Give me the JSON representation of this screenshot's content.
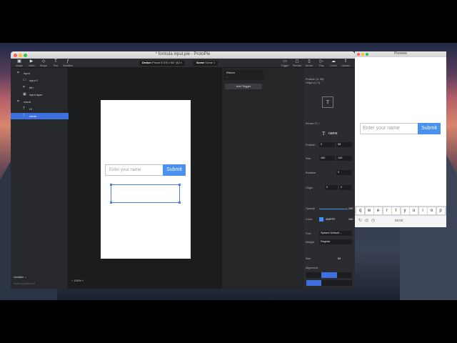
{
  "main_window": {
    "title": "* formula input.pie - ProtoPie",
    "toolbar": {
      "tools": [
        {
          "label": "Image",
          "icon": "image-icon",
          "glyph": "▣"
        },
        {
          "label": "Video",
          "icon": "video-icon",
          "glyph": "▶"
        },
        {
          "label": "Shape",
          "icon": "shape-icon",
          "glyph": "◇"
        },
        {
          "label": "Text",
          "icon": "text-icon",
          "glyph": "T"
        },
        {
          "label": "Variables",
          "icon": "variables-icon",
          "glyph": "ƒ"
        }
      ],
      "device_label": "Device",
      "device_value": "iPhone 8  375 x 667  @2 x",
      "scene_label": "Scene",
      "scene_value": "Scene 1",
      "right_tools": [
        {
          "label": "Trigger",
          "icon": "trigger-icon",
          "glyph": "▭"
        },
        {
          "label": "Preview",
          "icon": "preview-icon",
          "glyph": "◻"
        },
        {
          "label": "Device",
          "icon": "device-icon",
          "glyph": "▯"
        },
        {
          "label": "Play",
          "icon": "play-icon",
          "glyph": "▷"
        },
        {
          "label": "Cloud",
          "icon": "cloud-icon",
          "glyph": "☁"
        },
        {
          "label": "Upload",
          "icon": "upload-icon",
          "glyph": "⇪"
        }
      ]
    },
    "layers": [
      {
        "label": "input",
        "icon": "group-icon",
        "glyph": "⌗",
        "indent": 0,
        "selected": false
      },
      {
        "label": "input 1",
        "icon": "rect-icon",
        "glyph": "▭",
        "indent": 1,
        "selected": false
      },
      {
        "label": "btn",
        "icon": "group-icon",
        "glyph": "⌗",
        "indent": 1,
        "selected": false
      },
      {
        "label": "input layer",
        "icon": "image-icon",
        "glyph": "▣",
        "indent": 1,
        "selected": false
      },
      {
        "label": "result",
        "icon": "group-icon",
        "glyph": "⌗",
        "indent": 0,
        "selected": false
      },
      {
        "label": "Hi",
        "icon": "text-icon",
        "glyph": "T",
        "indent": 1,
        "selected": false
      },
      {
        "label": "name",
        "icon": "text-icon",
        "glyph": "T",
        "indent": 1,
        "selected": true
      }
    ],
    "variables": {
      "label": "Variable",
      "placeholder": "Nothing selected"
    },
    "zoom": "100%",
    "canvas": {
      "input_placeholder": "Enter your name",
      "button_label": "Submit"
    },
    "interactions": {
      "trigger_label": "Return",
      "trigger_sub": "+",
      "add_trigger": "Add Trigger"
    },
    "props": {
      "position_info": "Position  (0, 58)",
      "origin_info": "Origin  (0, 0)",
      "resize_info": "Resize  T1  ↕",
      "layer_name": "name",
      "position": {
        "label": "Position",
        "x": "0",
        "y": "58"
      },
      "size": {
        "label": "Size",
        "w": "280",
        "h": "140"
      },
      "rotation": {
        "label": "Rotation",
        "value": "0"
      },
      "origin": {
        "label": "Origin",
        "x": "0",
        "y": "0"
      },
      "opacity": {
        "label": "Opacity",
        "value": "100",
        "level": 1.0
      },
      "color": {
        "label": "Color",
        "hex": "408FFF",
        "alpha": "100",
        "swatch": "#408fff"
      },
      "font": {
        "label": "Font",
        "value": "System Default ..."
      },
      "weight": {
        "label": "Weight",
        "value": "Regular"
      },
      "size_font": {
        "label": "Size",
        "value": "60"
      },
      "alignment": {
        "label": "Alignment"
      }
    }
  },
  "preview_window": {
    "title": "Preview",
    "input_placeholder": "Enter your name",
    "button_label": "Submit",
    "keyboard_keys": [
      "q",
      "w",
      "e",
      "r",
      "t",
      "y",
      "u",
      "i",
      "o",
      "p"
    ],
    "time": "00:00"
  },
  "colors": {
    "accent": "#4a90f0",
    "selection": "#3d6fdf"
  }
}
